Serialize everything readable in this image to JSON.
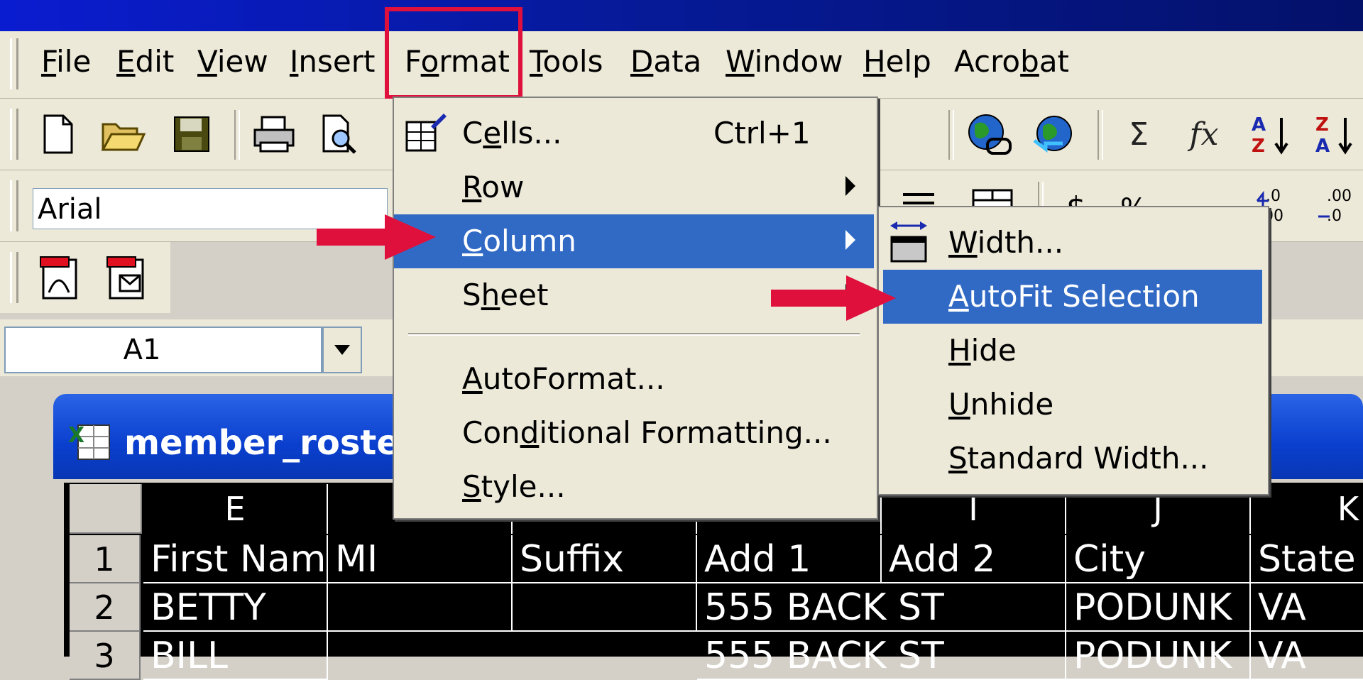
{
  "menubar": {
    "items": [
      {
        "label": "File",
        "u": "F",
        "rest": "ile"
      },
      {
        "label": "Edit",
        "u": "E",
        "rest": "dit"
      },
      {
        "label": "View",
        "u": "V",
        "rest": "iew"
      },
      {
        "label": "Insert",
        "u": "I",
        "rest": "nsert"
      },
      {
        "label": "Format",
        "pre": "F",
        "u": "o",
        "rest": "rmat"
      },
      {
        "label": "Tools",
        "u": "T",
        "rest": "ools"
      },
      {
        "label": "Data",
        "u": "D",
        "rest": "ata"
      },
      {
        "label": "Window",
        "u": "W",
        "rest": "indow"
      },
      {
        "label": "Help",
        "u": "H",
        "rest": "elp"
      },
      {
        "label": "Acrobat",
        "pre": "Acro",
        "u": "b",
        "rest": "at"
      }
    ]
  },
  "toolbar": {
    "font_name": "Arial",
    "sum_symbol": "Σ",
    "fx_symbol": "fx"
  },
  "formula_bar": {
    "name_box": "A1"
  },
  "workbook": {
    "title": "member_roster"
  },
  "format_menu": {
    "items": [
      {
        "pre": "C",
        "u": "e",
        "rest": "lls...",
        "shortcut": "Ctrl+1",
        "has_submenu": false
      },
      {
        "pre": "",
        "u": "R",
        "rest": "ow",
        "shortcut": "",
        "has_submenu": true
      },
      {
        "pre": "",
        "u": "C",
        "rest": "olumn",
        "shortcut": "",
        "has_submenu": true,
        "selected": true
      },
      {
        "pre": "S",
        "u": "h",
        "rest": "eet",
        "shortcut": "",
        "has_submenu": true
      },
      {
        "pre": "",
        "u": "A",
        "rest": "utoFormat...",
        "shortcut": "",
        "has_submenu": false
      },
      {
        "pre": "Con",
        "u": "d",
        "rest": "itional Formatting...",
        "shortcut": "",
        "has_submenu": false
      },
      {
        "pre": "",
        "u": "S",
        "rest": "tyle...",
        "shortcut": "",
        "has_submenu": false
      }
    ]
  },
  "column_submenu": {
    "items": [
      {
        "pre": "",
        "u": "W",
        "rest": "idth..."
      },
      {
        "pre": "",
        "u": "A",
        "rest": "utoFit Selection",
        "selected": true
      },
      {
        "pre": "",
        "u": "H",
        "rest": "ide"
      },
      {
        "pre": "",
        "u": "U",
        "rest": "nhide"
      },
      {
        "pre": "",
        "u": "S",
        "rest": "tandard Width..."
      }
    ]
  },
  "sheet": {
    "columns": [
      "E",
      "",
      "",
      "",
      "I",
      "J",
      "K"
    ],
    "rows": [
      {
        "num": "1",
        "cells": [
          "First Name",
          "MI",
          "Suffix",
          "Add 1",
          "Add 2",
          "City",
          "State"
        ]
      },
      {
        "num": "2",
        "cells": [
          "BETTY",
          "",
          "",
          "555 BACK ST",
          "",
          "PODUNK",
          "VA"
        ]
      },
      {
        "num": "3",
        "cells": [
          "BILL",
          "",
          "",
          "555 BACK ST",
          "",
          "PODUNK",
          "VA"
        ]
      }
    ]
  },
  "colors": {
    "highlight": "#316ac5",
    "annotation_red": "#e0103c",
    "title_blue": "#0a3fce"
  }
}
